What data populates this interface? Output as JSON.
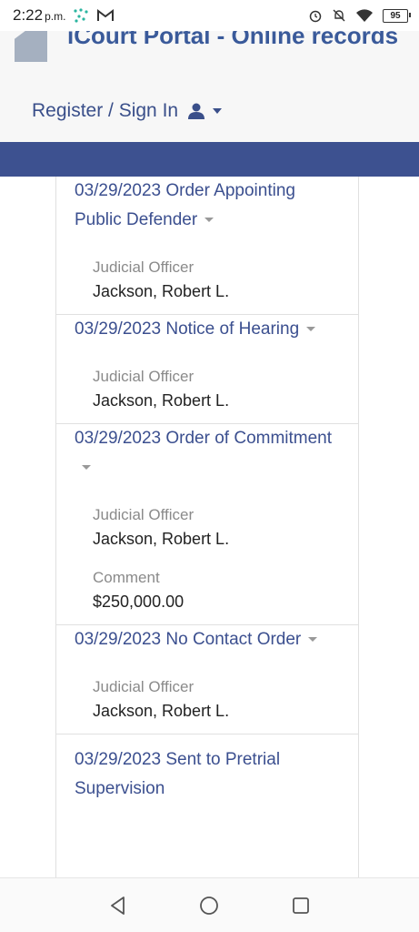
{
  "status_bar": {
    "time": "2:22",
    "ampm": "p.m.",
    "battery": "95"
  },
  "header": {
    "portal_title": "iCourt Portal - Online records",
    "signin_label": "Register / Sign In"
  },
  "entries": [
    {
      "title": "03/29/2023 Order Appointing Public Defender",
      "officer_label": "Judicial Officer",
      "officer": "Jackson, Robert L."
    },
    {
      "title": "03/29/2023 Notice of Hearing",
      "officer_label": "Judicial Officer",
      "officer": "Jackson, Robert L."
    },
    {
      "title": "03/29/2023 Order of Commitment",
      "officer_label": "Judicial Officer",
      "officer": "Jackson, Robert L.",
      "comment_label": "Comment",
      "comment": "$250,000.00"
    },
    {
      "title": "03/29/2023 No Contact Order",
      "officer_label": "Judicial Officer",
      "officer": "Jackson, Robert L."
    },
    {
      "title": "03/29/2023 Sent to Pretrial Supervision"
    }
  ],
  "colors": {
    "accent": "#3d5190",
    "link": "#3b4f8f"
  },
  "icons": {
    "nav_back": "back-triangle-icon",
    "nav_home": "home-circle-icon",
    "nav_recent": "recents-square-icon"
  }
}
